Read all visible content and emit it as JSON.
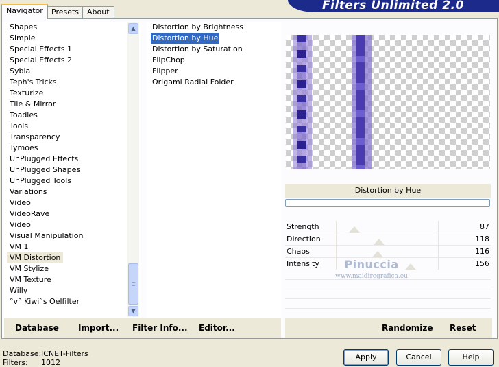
{
  "banner": {
    "title": "Filters Unlimited 2.0"
  },
  "tabs": [
    {
      "label": "Navigator",
      "active": true
    },
    {
      "label": "Presets",
      "active": false
    },
    {
      "label": "About",
      "active": false
    }
  ],
  "categories": {
    "items": [
      "Shapes",
      "Simple",
      "Special Effects 1",
      "Special Effects 2",
      "Sybia",
      "Teph's Tricks",
      "Texturize",
      "Tile & Mirror",
      "Toadies",
      "Tools",
      "Transparency",
      "Tymoes",
      "UnPlugged Effects",
      "UnPlugged Shapes",
      "UnPlugged Tools",
      "Variations",
      "Video",
      "VideoRave",
      "Video",
      "Visual Manipulation",
      "VM 1",
      "VM Distortion",
      "VM Stylize",
      "VM Texture",
      "Willy",
      "°v° Kiwi`s Oelfilter"
    ],
    "selected": "VM Distortion"
  },
  "filters": {
    "items": [
      "Distortion by Brightness",
      "Distortion by Hue",
      "Distortion by Saturation",
      "FlipChop",
      "Flipper",
      "Origami Radial Folder"
    ],
    "selected": "Distortion by Hue"
  },
  "preview": {
    "filter_name": "Distortion by Hue"
  },
  "params": [
    {
      "label": "Strength",
      "value": "87"
    },
    {
      "label": "Direction",
      "value": "118"
    },
    {
      "label": "Chaos",
      "value": "116"
    },
    {
      "label": "Intensity",
      "value": "156"
    }
  ],
  "watermark": {
    "name": "Pinuccia",
    "url": "www.maidiregrafica.eu"
  },
  "toolbar": {
    "database": "Database",
    "import": "Import...",
    "filter_info": "Filter Info...",
    "editor": "Editor...",
    "randomize": "Randomize",
    "reset": "Reset"
  },
  "status": {
    "database_label": "Database:",
    "database_value": "ICNET-Filters",
    "filters_label": "Filters:",
    "filters_value": "1012"
  },
  "dialog": {
    "apply": "Apply",
    "cancel": "Cancel",
    "help": "Help"
  },
  "colors": {
    "banner": "#1c2a8c",
    "selection": "#316ac5",
    "stripe": "#3a2fa0"
  },
  "icons": {
    "scroll_up": "chevron-up-icon",
    "scroll_down": "chevron-down-icon"
  }
}
